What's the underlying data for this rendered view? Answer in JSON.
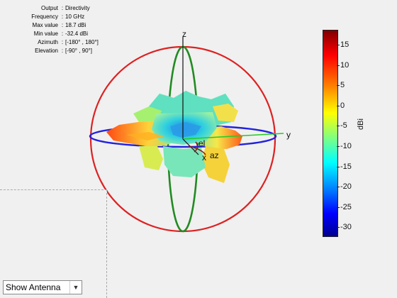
{
  "info": {
    "rows": [
      {
        "key": "Output",
        "value": "Directivity"
      },
      {
        "key": "Frequency",
        "value": "10 GHz"
      },
      {
        "key": "Max value",
        "value": "18.7 dBi"
      },
      {
        "key": "Min value",
        "value": "-32.4 dBi"
      },
      {
        "key": "Azimuth",
        "value": "[-180° , 180°]"
      },
      {
        "key": "Elevation",
        "value": "[-90° , 90°]"
      }
    ],
    "separator": ":"
  },
  "axes": {
    "x": "x",
    "y": "y",
    "z": "z",
    "az": "az",
    "el": "el"
  },
  "colorbar": {
    "unit": "dBi",
    "ticks": [
      "15",
      "10",
      "5",
      "0",
      "-5",
      "-10",
      "-15",
      "-20",
      "-25",
      "-30"
    ],
    "max": 18.7,
    "min": -32.4,
    "colormap": "jet"
  },
  "colors": {
    "azimuth_circle": "#2222dd",
    "elevation_circle_red": "#dd2222",
    "elevation_circle_green": "#228b22",
    "y_axis": "#22cc22"
  },
  "controls": {
    "view_select": {
      "value": "Show Antenna",
      "options": [
        "Show Antenna"
      ]
    }
  }
}
